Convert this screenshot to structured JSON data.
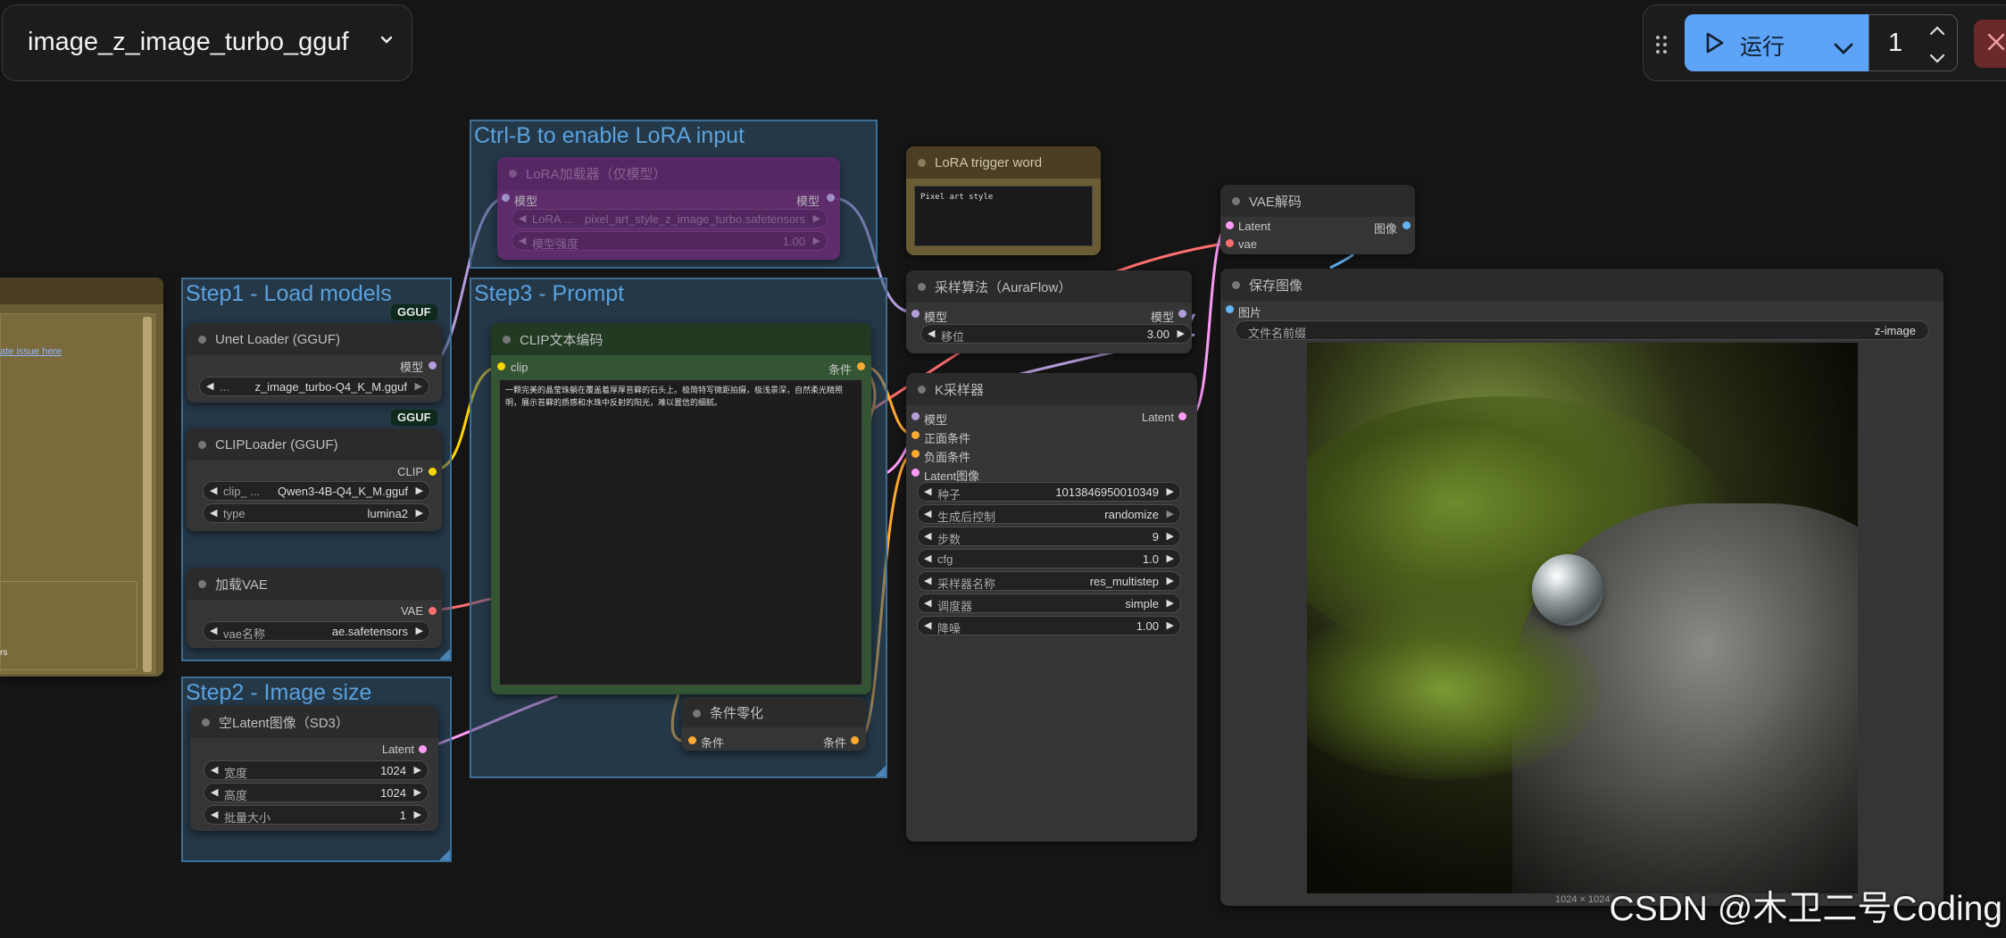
{
  "workflow": {
    "title": "image_z_image_turbo_gguf"
  },
  "toolbar": {
    "run_label": "运行",
    "queue_count": "1"
  },
  "groups": {
    "lora": "Ctrl-B to enable LoRA input",
    "step1": "Step1 - Load models",
    "step2": "Step2 - Image size",
    "step3": "Step3 - Prompt"
  },
  "note": {
    "link_text": "ate issue here",
    "bottom_text": "rs"
  },
  "nodes": {
    "lora_loader": {
      "title": "LoRA加载器（仅模型）",
      "in": "模型",
      "out": "模型",
      "w1_label": "LoRA ...",
      "w1_value": "pixel_art_style_z_image_turbo.safetensors",
      "w2_label": "模型强度",
      "w2_value": "1.00"
    },
    "lora_trigger": {
      "title": "LoRA trigger word",
      "text": "Pixel art style"
    },
    "vae_decode": {
      "title": "VAE解码",
      "in1": "Latent",
      "in2": "vae",
      "out": "图像"
    },
    "save_image": {
      "title": "保存图像",
      "in": "图片",
      "prefix_label": "文件名前缀",
      "prefix_value": "z-image",
      "size_caption": "1024 × 1024"
    },
    "unet": {
      "title": "Unet Loader (GGUF)",
      "badge": "GGUF",
      "out": "模型",
      "w_label": "...",
      "w_value": "z_image_turbo-Q4_K_M.gguf"
    },
    "clip_loader": {
      "title": "CLIPLoader (GGUF)",
      "badge": "GGUF",
      "out": "CLIP",
      "w1_label": "clip_ ...",
      "w1_value": "Qwen3-4B-Q4_K_M.gguf",
      "w2_label": "type",
      "w2_value": "lumina2"
    },
    "vae_loader": {
      "title": "加载VAE",
      "out": "VAE",
      "w_label": "vae名称",
      "w_value": "ae.safetensors"
    },
    "latent": {
      "title": "空Latent图像（SD3）",
      "out": "Latent",
      "widgets": [
        {
          "label": "宽度",
          "value": "1024"
        },
        {
          "label": "高度",
          "value": "1024"
        },
        {
          "label": "批量大小",
          "value": "1"
        }
      ]
    },
    "clip_text": {
      "title": "CLIP文本编码",
      "in": "clip",
      "out": "条件",
      "prompt": "一颗完美的晶莹珠躺在覆盖着厚厚苔藓的石头上。极简特写微距拍摄，极浅景深，自然柔光精照明，展示苔藓的质感和水珠中反射的阳光，难以置信的细腻。"
    },
    "zero_cond": {
      "title": "条件零化",
      "in": "条件",
      "out": "条件"
    },
    "auraflow": {
      "title": "采样算法（AuraFlow）",
      "in": "模型",
      "out": "模型",
      "w_label": "移位",
      "w_value": "3.00"
    },
    "ksampler": {
      "title": "K采样器",
      "inputs": [
        "模型",
        "正面条件",
        "负面条件",
        "Latent图像"
      ],
      "out": "Latent",
      "widgets": [
        {
          "label": "种子",
          "value": "1013846950010349"
        },
        {
          "label": "生成后控制",
          "value": "randomize"
        },
        {
          "label": "步数",
          "value": "9"
        },
        {
          "label": "cfg",
          "value": "1.0"
        },
        {
          "label": "采样器名称",
          "value": "res_multistep"
        },
        {
          "label": "调度器",
          "value": "simple"
        },
        {
          "label": "降噪",
          "value": "1.00"
        }
      ]
    }
  },
  "watermark": "CSDN @木卫二号Coding",
  "colors": {
    "model_pin": "#b39ddb",
    "clip_pin": "#ffd500",
    "vae_pin": "#ff6e6e",
    "latent_pin": "#ff9cf9",
    "cond_pin": "#ffa931",
    "image_pin": "#64b5f6",
    "run_button": "#5da3f7"
  }
}
